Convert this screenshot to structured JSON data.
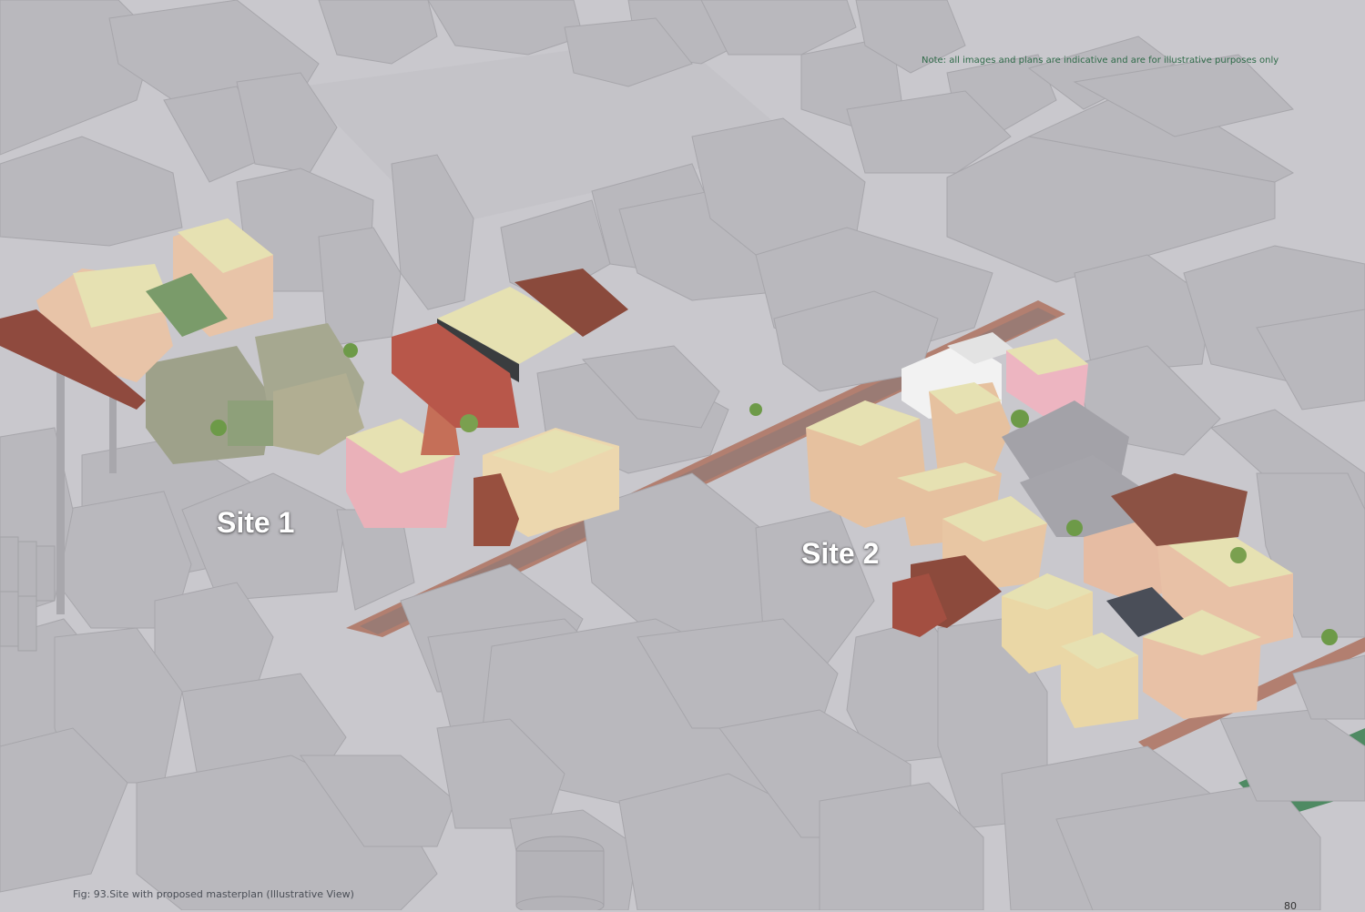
{
  "note": "Note: all images and plans are indicative and are for illustrative purposes only",
  "labels": {
    "site1": "Site 1",
    "site2": "Site 2"
  },
  "caption": "Fig: 93.Site with proposed masterplan (Illustrative View)",
  "page_number": "80",
  "colors": {
    "context_building": "#b9b8bd",
    "ground": "#c9c8cd",
    "road": "#b07a6c",
    "proposed_cream": "#e6dfae",
    "proposed_peach": "#e4bfa1",
    "proposed_pink": "#e6aeb4",
    "note_text": "#2e6a48",
    "label_text": "#ffffff"
  }
}
